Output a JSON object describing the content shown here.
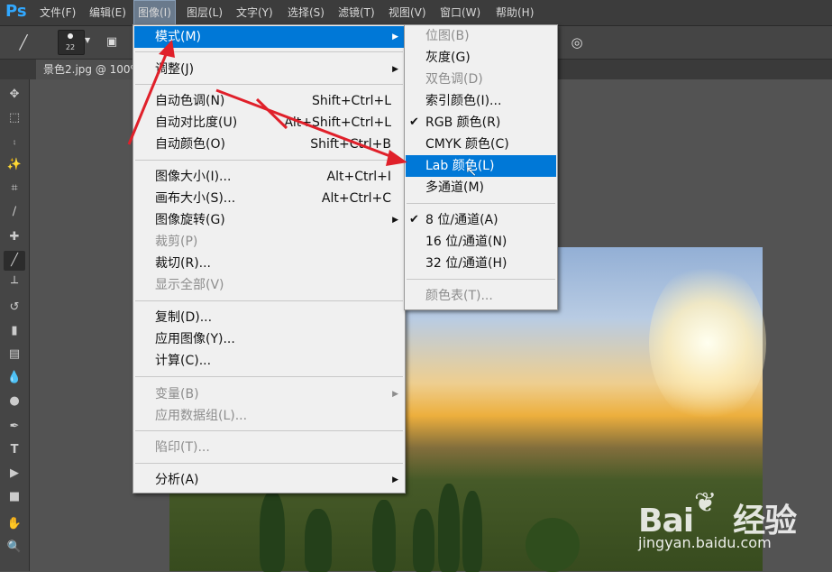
{
  "app": {
    "logo": "Ps"
  },
  "menubar": [
    {
      "label": "文件(F)"
    },
    {
      "label": "编辑(E)"
    },
    {
      "label": "图像(I)"
    },
    {
      "label": "图层(L)"
    },
    {
      "label": "文字(Y)"
    },
    {
      "label": "选择(S)"
    },
    {
      "label": "滤镜(T)"
    },
    {
      "label": "视图(V)"
    },
    {
      "label": "窗口(W)"
    },
    {
      "label": "帮助(H)"
    }
  ],
  "options_bar": {
    "brush_size": "22"
  },
  "document_tab": {
    "label": "景色2.jpg @ 100%"
  },
  "image_menu": {
    "items": [
      {
        "label": "模式(M)",
        "shortcut": "",
        "submenu": true
      },
      {
        "label": "调整(J)",
        "shortcut": "",
        "submenu": true
      },
      {
        "label": "自动色调(N)",
        "shortcut": "Shift+Ctrl+L"
      },
      {
        "label": "自动对比度(U)",
        "shortcut": "Alt+Shift+Ctrl+L"
      },
      {
        "label": "自动颜色(O)",
        "shortcut": "Shift+Ctrl+B"
      },
      {
        "label": "图像大小(I)...",
        "shortcut": "Alt+Ctrl+I"
      },
      {
        "label": "画布大小(S)...",
        "shortcut": "Alt+Ctrl+C"
      },
      {
        "label": "图像旋转(G)",
        "shortcut": "",
        "submenu": true
      },
      {
        "label": "裁剪(P)",
        "shortcut": "",
        "disabled": true
      },
      {
        "label": "裁切(R)...",
        "shortcut": ""
      },
      {
        "label": "显示全部(V)",
        "shortcut": "",
        "disabled": true
      },
      {
        "label": "复制(D)...",
        "shortcut": ""
      },
      {
        "label": "应用图像(Y)...",
        "shortcut": ""
      },
      {
        "label": "计算(C)...",
        "shortcut": ""
      },
      {
        "label": "变量(B)",
        "shortcut": "",
        "submenu": true,
        "disabled": true
      },
      {
        "label": "应用数据组(L)...",
        "shortcut": "",
        "disabled": true
      },
      {
        "label": "陷印(T)...",
        "shortcut": "",
        "disabled": true
      },
      {
        "label": "分析(A)",
        "shortcut": "",
        "submenu": true
      }
    ]
  },
  "mode_submenu": {
    "items": [
      {
        "label": "位图(B)",
        "disabled": true
      },
      {
        "label": "灰度(G)"
      },
      {
        "label": "双色调(D)",
        "disabled": true
      },
      {
        "label": "索引颜色(I)..."
      },
      {
        "label": "RGB 颜色(R)",
        "checked": true
      },
      {
        "label": "CMYK 颜色(C)"
      },
      {
        "label": "Lab 颜色(L)",
        "highlighted": true
      },
      {
        "label": "多通道(M)"
      },
      {
        "label": "8 位/通道(A)",
        "checked": true
      },
      {
        "label": "16 位/通道(N)"
      },
      {
        "label": "32 位/通道(H)"
      },
      {
        "label": "颜色表(T)...",
        "disabled": true
      }
    ]
  },
  "watermark": {
    "brand": "Bai",
    "brand2": "经验",
    "url": "jingyan.baidu.com"
  },
  "colors": {
    "highlight": "#0078d7",
    "arrow": "#e0202a",
    "ps_blue": "#31a8ff"
  }
}
